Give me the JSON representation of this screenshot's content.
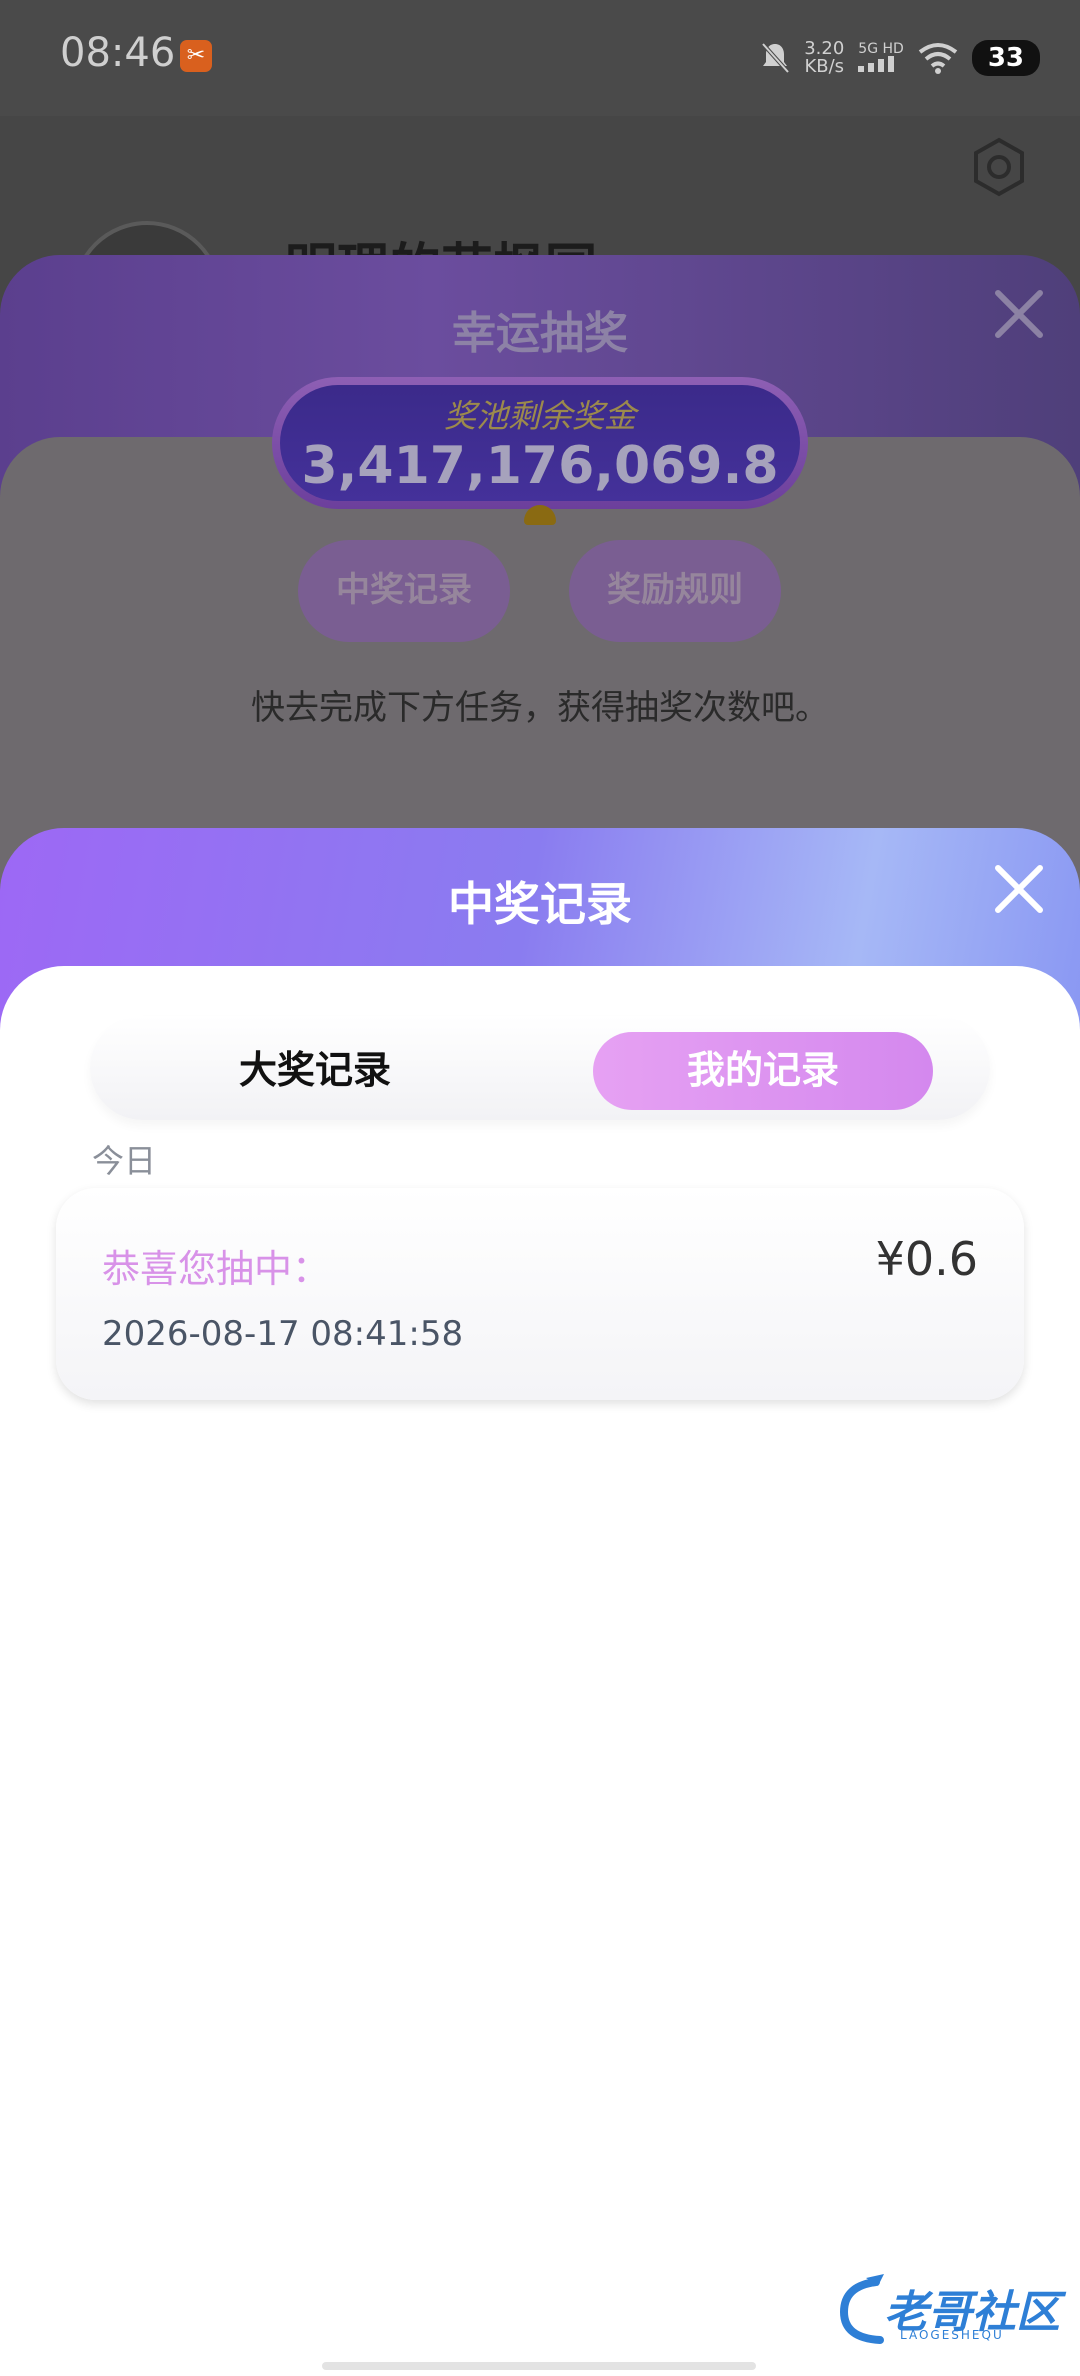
{
  "status_bar": {
    "time": "08:46",
    "speed_value": "3.20",
    "speed_unit": "KB/s",
    "network": "5G HD",
    "battery": "33"
  },
  "profile": {
    "nickname": "明理的花枫园"
  },
  "lottery": {
    "title": "幸运抽奖",
    "pool_label": "奖池剩余奖金",
    "pool_value": "3,417,176,069.8",
    "records_button": "中奖记录",
    "rules_button": "奖励规则",
    "hint": "快去完成下方任务，获得抽奖次数吧。"
  },
  "modal": {
    "title": "中奖记录",
    "tabs": [
      {
        "label": "大奖记录",
        "active": false
      },
      {
        "label": "我的记录",
        "active": true
      }
    ],
    "section_date": "今日",
    "records": [
      {
        "label": "恭喜您抽中：",
        "amount": "¥0.6",
        "time": "2026-08-17 08:41:58"
      }
    ]
  },
  "watermark": {
    "text": "老哥社区",
    "sub": "LAOGESHEQU"
  },
  "colors": {
    "modal_gradient_start": "#9d68f5",
    "tab_active": "#d488ee",
    "record_label": "#d892e8"
  }
}
